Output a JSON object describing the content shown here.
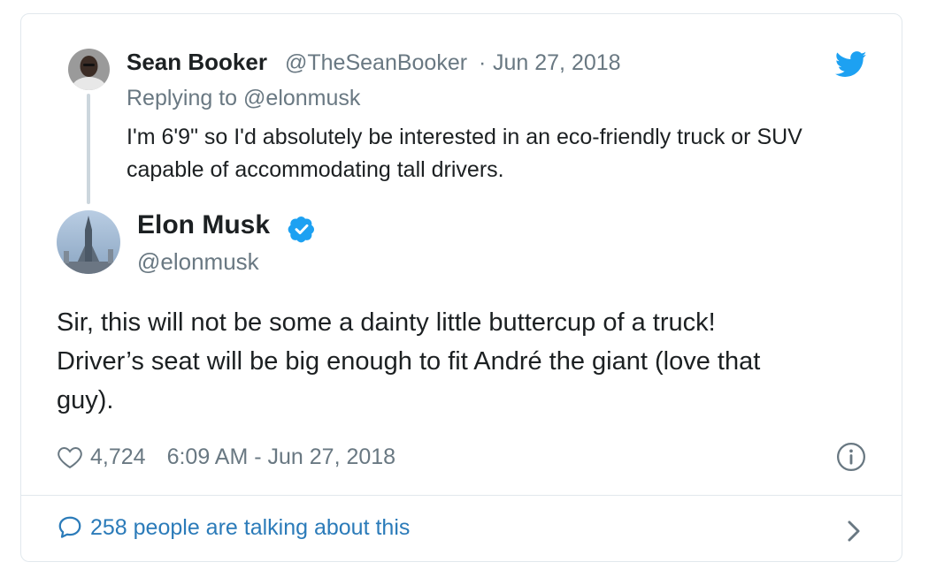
{
  "reply": {
    "name": "Sean Booker",
    "handle": "@TheSeanBooker",
    "separator": "·",
    "date": "Jun 27, 2018",
    "replying_prefix": "Replying to",
    "replying_to": "@elonmusk",
    "text": "I'm 6'9\" so I'd  absolutely be interested in an eco-friendly truck or SUV capable of accommodating tall drivers."
  },
  "tweet": {
    "name": "Elon Musk",
    "handle": "@elonmusk",
    "verified": true,
    "text_line1": "Sir, this will not be some a dainty little buttercup of a truck!",
    "text_line2": "Driver’s seat will be big enough to fit André the giant (love that",
    "text_line3": "guy).",
    "likes": "4,724",
    "timestamp": "6:09 AM - Jun 27, 2018"
  },
  "footer": {
    "talking": "258 people are talking about this"
  },
  "icons": {
    "brand": "twitter-bird-icon",
    "verified": "verified-badge-icon",
    "like": "heart-icon",
    "info": "info-icon",
    "comment": "speech-bubble-icon",
    "chevron": "chevron-right-icon"
  },
  "colors": {
    "twitter_blue": "#1da1f2",
    "link_blue": "#2b7bb9",
    "secondary_text": "#697882",
    "primary_text": "#1c2022",
    "border": "#e1e8ed"
  }
}
